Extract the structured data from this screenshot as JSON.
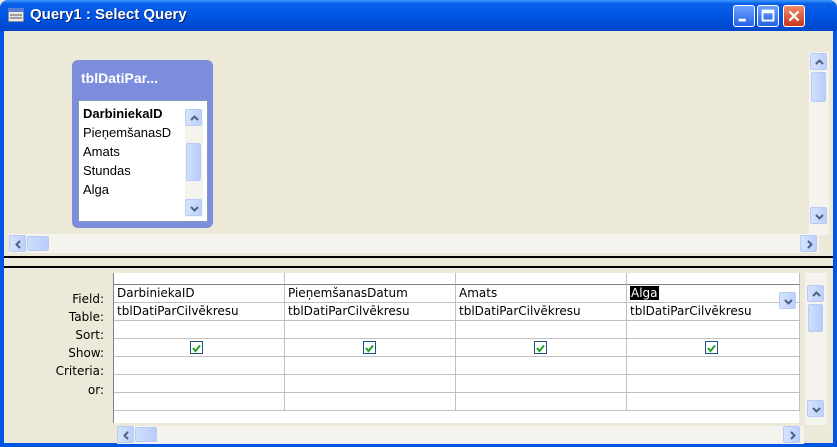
{
  "window": {
    "title": "Query1 : Select Query",
    "buttons": {
      "minimize": "minimize-icon",
      "maximize": "maximize-icon",
      "close": "close-icon"
    }
  },
  "field_list": {
    "title": "tblDatiPar...",
    "items": [
      "DarbiniekaID",
      "PieņemšanasD",
      "Amats",
      "Stundas",
      "Alga"
    ],
    "bold_item": "DarbiniekaID"
  },
  "grid": {
    "row_labels": [
      "Field:",
      "Table:",
      "Sort:",
      "Show:",
      "Criteria:",
      "or:"
    ],
    "columns": [
      {
        "field": "DarbiniekaID",
        "table": "tblDatiParCilvēkresu",
        "sort": "",
        "show": true,
        "criteria": "",
        "or": ""
      },
      {
        "field": "PieņemšanasDatum",
        "table": "tblDatiParCilvēkresu",
        "sort": "",
        "show": true,
        "criteria": "",
        "or": ""
      },
      {
        "field": "Amats",
        "table": "tblDatiParCilvēkresu",
        "sort": "",
        "show": true,
        "criteria": "",
        "or": ""
      },
      {
        "field": "Alga",
        "table": "tblDatiParCilvēkresu",
        "sort": "",
        "show": true,
        "criteria": "",
        "or": "",
        "selected": true
      }
    ]
  },
  "colors": {
    "titlebar": "#0054e3",
    "field_list_frame": "#7d8dde",
    "check": "#21a121"
  }
}
